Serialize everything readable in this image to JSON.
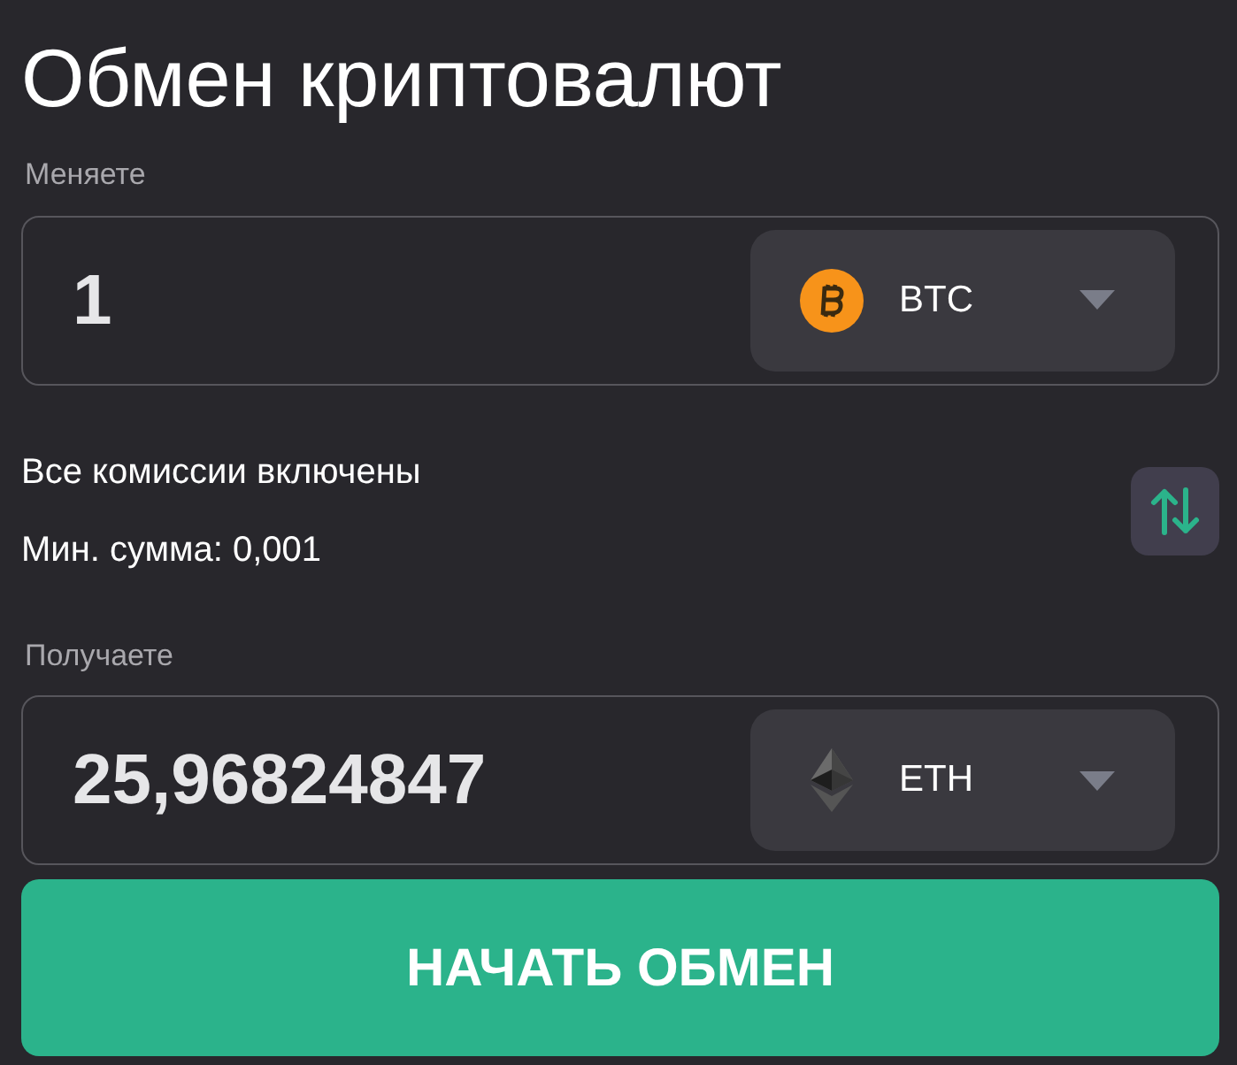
{
  "title": "Обмен криптовалют",
  "give": {
    "label": "Меняете",
    "amount": "1",
    "currency": {
      "kind": "btc",
      "code": "BTC"
    }
  },
  "info": [
    "Все комиссии включены",
    "Мин. сумма: 0,001"
  ],
  "get": {
    "label": "Получаете",
    "amount": "25,96824847",
    "currency": {
      "kind": "eth",
      "code": "ETH"
    }
  },
  "submit": "НАЧАТЬ ОБМЕН"
}
